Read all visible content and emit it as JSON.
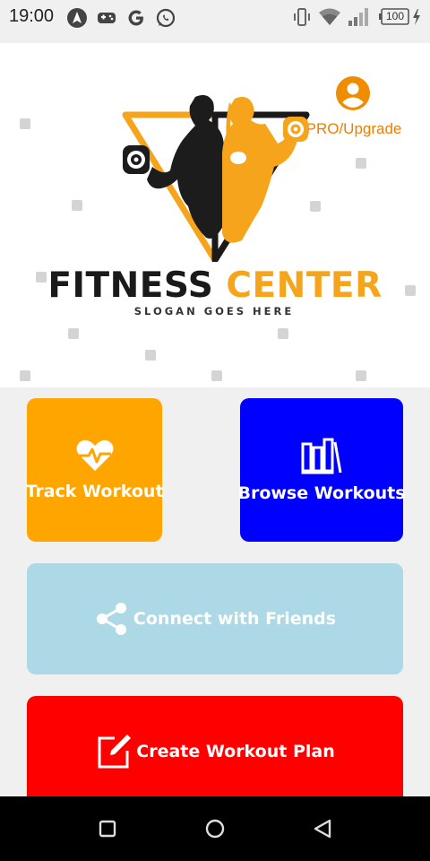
{
  "status_bar": {
    "time": "19:00",
    "app_icons": [
      "navigation-app-icon",
      "gamepad-icon",
      "google-icon",
      "whatsapp-icon"
    ],
    "battery": "100",
    "system_icons": [
      "vibrate-icon",
      "wifi-icon",
      "signal-icon",
      "battery-icon",
      "charging-icon"
    ]
  },
  "header": {
    "pro_label": "PRO/Upgrade",
    "avatar_icon": "account-circle-icon"
  },
  "logo": {
    "title_part1": "FITNESS",
    "title_part2": "CENTER",
    "slogan": "SLOGAN GOES HERE"
  },
  "tiles": {
    "track": {
      "label": "Track Workout",
      "icon": "heart-pulse-icon",
      "color": "#ffa500"
    },
    "browse": {
      "label": "Browse Workouts",
      "icon": "library-books-icon",
      "color": "#0000ff"
    },
    "connect": {
      "label": "Connect with Friends",
      "icon": "share-icon",
      "color": "#add8e6"
    },
    "create": {
      "label": "Create Workout Plan",
      "icon": "edit-note-icon",
      "color": "#ff0000"
    }
  },
  "nav": {
    "buttons": [
      "recents-button",
      "home-button",
      "back-button"
    ]
  },
  "colors": {
    "accent_orange": "#f5a41b",
    "pro_orange": "#ef7d00",
    "background": "#f0f0f0"
  }
}
